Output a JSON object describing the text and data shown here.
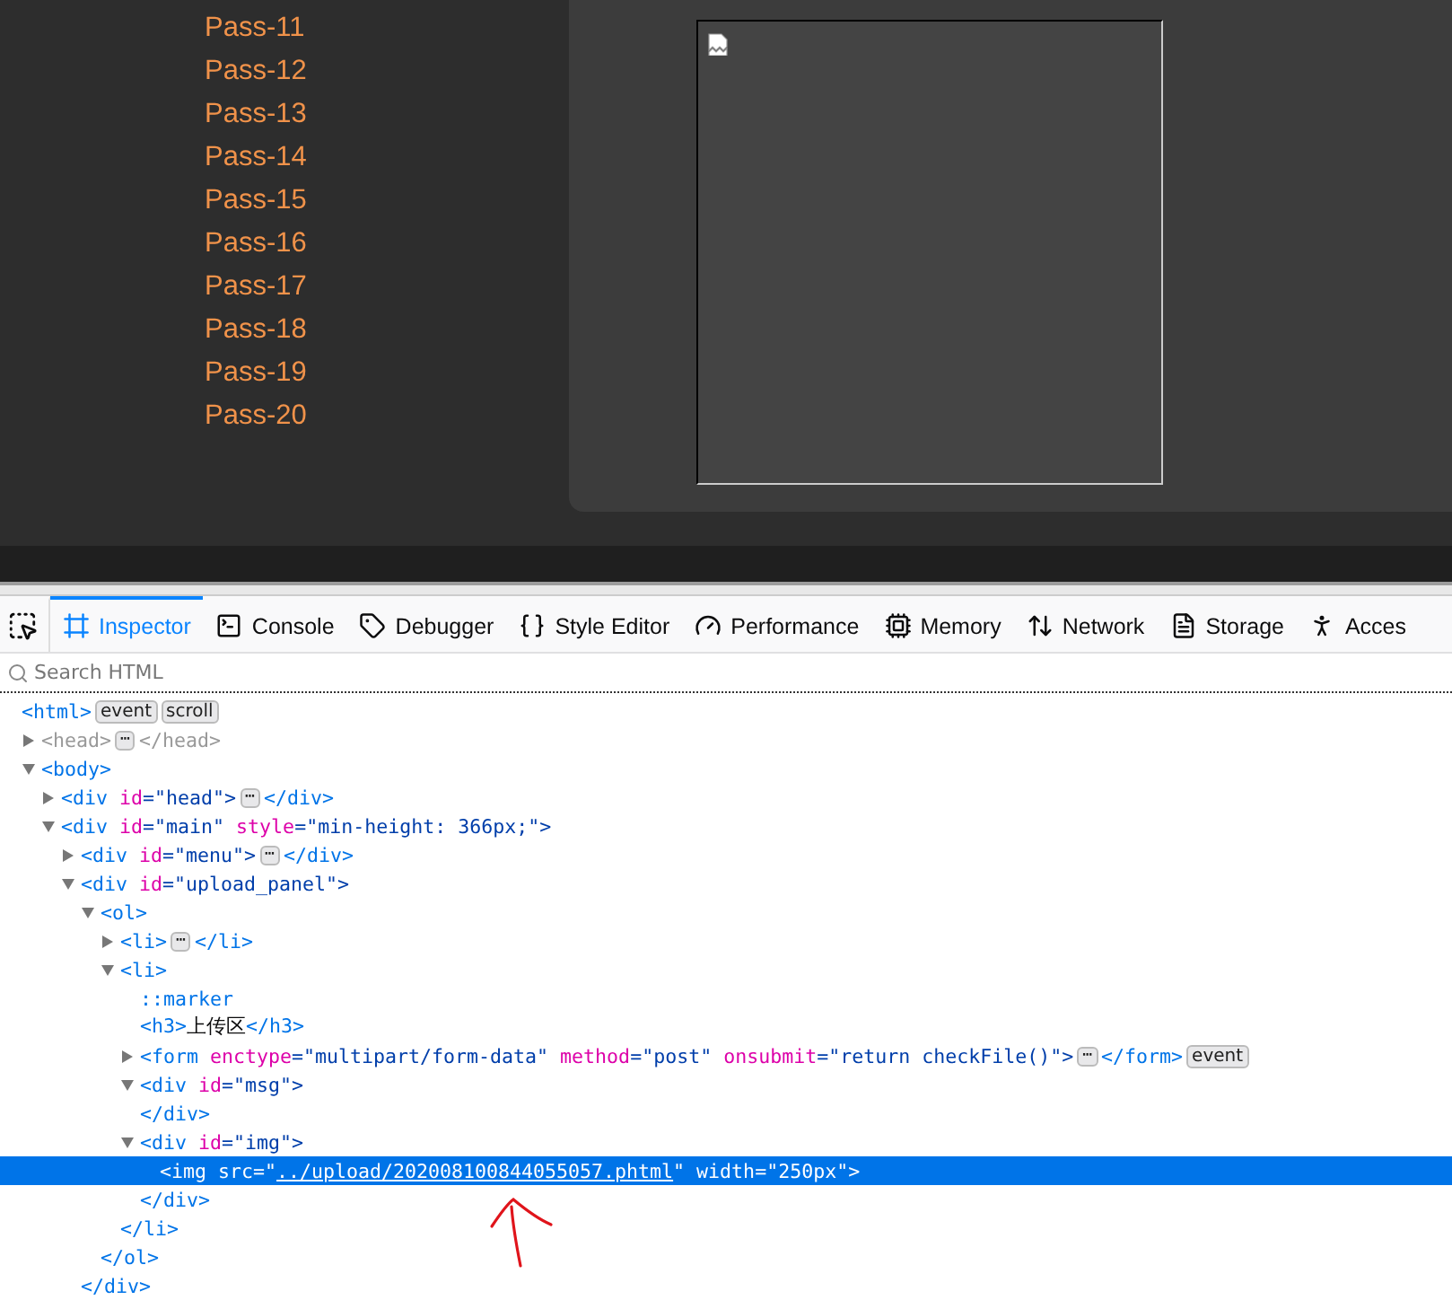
{
  "page": {
    "menu": [
      "Pass-11",
      "Pass-12",
      "Pass-13",
      "Pass-14",
      "Pass-15",
      "Pass-16",
      "Pass-17",
      "Pass-18",
      "Pass-19",
      "Pass-20"
    ]
  },
  "devtools": {
    "tabs": [
      {
        "kind": "picker",
        "selected": false
      },
      {
        "kind": "inspector",
        "label": "Inspector",
        "selected": true
      },
      {
        "kind": "console",
        "label": "Console",
        "selected": false
      },
      {
        "kind": "debugger",
        "label": "Debugger",
        "selected": false
      },
      {
        "kind": "style",
        "label": "Style Editor",
        "selected": false
      },
      {
        "kind": "performance",
        "label": "Performance",
        "selected": false
      },
      {
        "kind": "memory",
        "label": "Memory",
        "selected": false
      },
      {
        "kind": "network",
        "label": "Network",
        "selected": false
      },
      {
        "kind": "storage",
        "label": "Storage",
        "selected": false
      },
      {
        "kind": "accessibility",
        "label": "Acces",
        "selected": false
      }
    ],
    "search": {
      "placeholder": "Search HTML"
    },
    "tree": [
      {
        "selected": false,
        "dim": false,
        "line": [
          {
            "kind": "code",
            "tokens": [
              {
                "kind": "tag",
                "text": "<html>"
              }
            ]
          },
          {
            "kind": "badge",
            "label": "event"
          },
          {
            "kind": "badge",
            "label": "scroll"
          }
        ],
        "children": [
          {
            "expanded": false,
            "selected": false,
            "dim": true,
            "line": [
              {
                "kind": "code",
                "tokens": [
                  {
                    "kind": "tag",
                    "text": "<head>"
                  }
                ]
              },
              {
                "kind": "more",
                "label": "⋯"
              },
              {
                "kind": "code",
                "tokens": [
                  {
                    "kind": "tag",
                    "text": "</head>"
                  }
                ]
              }
            ]
          },
          {
            "expanded": true,
            "selected": false,
            "dim": false,
            "line": [
              {
                "kind": "code",
                "tokens": [
                  {
                    "kind": "tag",
                    "text": "<body>"
                  }
                ]
              }
            ],
            "children": [
              {
                "expanded": false,
                "selected": false,
                "dim": false,
                "line": [
                  {
                    "kind": "code",
                    "tokens": [
                      {
                        "kind": "tag",
                        "text": "<div"
                      },
                      {
                        "kind": "attr",
                        "text": " id"
                      },
                      {
                        "kind": "value",
                        "text": "=\"head\">"
                      }
                    ]
                  },
                  {
                    "kind": "more",
                    "label": "⋯"
                  },
                  {
                    "kind": "code",
                    "tokens": [
                      {
                        "kind": "tag",
                        "text": "</div>"
                      }
                    ]
                  }
                ]
              },
              {
                "expanded": true,
                "selected": false,
                "dim": false,
                "line": [
                  {
                    "kind": "code",
                    "tokens": [
                      {
                        "kind": "tag",
                        "text": "<div"
                      },
                      {
                        "kind": "attr",
                        "text": " id"
                      },
                      {
                        "kind": "value",
                        "text": "=\"main\""
                      },
                      {
                        "kind": "attr",
                        "text": " style"
                      },
                      {
                        "kind": "value",
                        "text": "=\"min-height: 366px;\">"
                      }
                    ]
                  }
                ],
                "children": [
                  {
                    "expanded": false,
                    "selected": false,
                    "dim": false,
                    "line": [
                      {
                        "kind": "code",
                        "tokens": [
                          {
                            "kind": "tag",
                            "text": "<div"
                          },
                          {
                            "kind": "attr",
                            "text": " id"
                          },
                          {
                            "kind": "value",
                            "text": "=\"menu\">"
                          }
                        ]
                      },
                      {
                        "kind": "more",
                        "label": "⋯"
                      },
                      {
                        "kind": "code",
                        "tokens": [
                          {
                            "kind": "tag",
                            "text": "</div>"
                          }
                        ]
                      }
                    ]
                  },
                  {
                    "expanded": true,
                    "selected": false,
                    "dim": false,
                    "line": [
                      {
                        "kind": "code",
                        "tokens": [
                          {
                            "kind": "tag",
                            "text": "<div"
                          },
                          {
                            "kind": "attr",
                            "text": " id"
                          },
                          {
                            "kind": "value",
                            "text": "=\"upload_panel\">"
                          }
                        ]
                      }
                    ],
                    "children": [
                      {
                        "expanded": true,
                        "selected": false,
                        "dim": false,
                        "line": [
                          {
                            "kind": "code",
                            "tokens": [
                              {
                                "kind": "tag",
                                "text": "<ol>"
                              }
                            ]
                          }
                        ],
                        "children": [
                          {
                            "expanded": false,
                            "selected": false,
                            "dim": false,
                            "line": [
                              {
                                "kind": "code",
                                "tokens": [
                                  {
                                    "kind": "tag",
                                    "text": "<li>"
                                  }
                                ]
                              },
                              {
                                "kind": "more",
                                "label": "⋯"
                              },
                              {
                                "kind": "code",
                                "tokens": [
                                  {
                                    "kind": "tag",
                                    "text": "</li>"
                                  }
                                ]
                              }
                            ]
                          },
                          {
                            "expanded": true,
                            "selected": false,
                            "dim": false,
                            "line": [
                              {
                                "kind": "code",
                                "tokens": [
                                  {
                                    "kind": "tag",
                                    "text": "<li>"
                                  }
                                ]
                              }
                            ],
                            "children": [
                              {
                                "selected": false,
                                "dim": false,
                                "line": [
                                  {
                                    "kind": "code",
                                    "tokens": [
                                      {
                                        "kind": "tag",
                                        "text": "::marker"
                                      }
                                    ]
                                  }
                                ]
                              },
                              {
                                "selected": false,
                                "dim": false,
                                "line": [
                                  {
                                    "kind": "code",
                                    "tokens": [
                                      {
                                        "kind": "tag",
                                        "text": "<h3>"
                                      },
                                      {
                                        "kind": "plain",
                                        "text": "上传区"
                                      },
                                      {
                                        "kind": "tag",
                                        "text": "</h3>"
                                      }
                                    ]
                                  }
                                ]
                              },
                              {
                                "expanded": false,
                                "selected": false,
                                "dim": false,
                                "line": [
                                  {
                                    "kind": "code",
                                    "tokens": [
                                      {
                                        "kind": "tag",
                                        "text": "<form"
                                      },
                                      {
                                        "kind": "attr",
                                        "text": " enctype"
                                      },
                                      {
                                        "kind": "value",
                                        "text": "=\"multipart/form-data\""
                                      },
                                      {
                                        "kind": "attr",
                                        "text": " method"
                                      },
                                      {
                                        "kind": "value",
                                        "text": "=\"post\""
                                      },
                                      {
                                        "kind": "attr",
                                        "text": " onsubmit"
                                      },
                                      {
                                        "kind": "value",
                                        "text": "=\"return checkFile()\">"
                                      }
                                    ]
                                  },
                                  {
                                    "kind": "more",
                                    "label": "⋯"
                                  },
                                  {
                                    "kind": "code",
                                    "tokens": [
                                      {
                                        "kind": "tag",
                                        "text": "</form>"
                                      }
                                    ]
                                  },
                                  {
                                    "kind": "badge",
                                    "label": "event"
                                  }
                                ]
                              },
                              {
                                "expanded": true,
                                "selected": false,
                                "dim": false,
                                "line": [
                                  {
                                    "kind": "code",
                                    "tokens": [
                                      {
                                        "kind": "tag",
                                        "text": "<div"
                                      },
                                      {
                                        "kind": "attr",
                                        "text": " id"
                                      },
                                      {
                                        "kind": "value",
                                        "text": "=\"msg\">"
                                      }
                                    ]
                                  }
                                ],
                                "close": "</div>"
                              },
                              {
                                "expanded": true,
                                "selected": false,
                                "dim": false,
                                "line": [
                                  {
                                    "kind": "code",
                                    "tokens": [
                                      {
                                        "kind": "tag",
                                        "text": "<div"
                                      },
                                      {
                                        "kind": "attr",
                                        "text": " id"
                                      },
                                      {
                                        "kind": "value",
                                        "text": "=\"img\">"
                                      }
                                    ]
                                  }
                                ],
                                "close": "</div>",
                                "children": [
                                  {
                                    "selected": true,
                                    "dim": false,
                                    "line": [
                                      {
                                        "kind": "code",
                                        "tokens": [
                                          {
                                            "kind": "tag",
                                            "text": "<img"
                                          },
                                          {
                                            "kind": "attr",
                                            "text": " src=\""
                                          },
                                          {
                                            "kind": "link",
                                            "text": "../upload/202008100844055057.phtml"
                                          },
                                          {
                                            "kind": "attr",
                                            "text": "\" width"
                                          },
                                          {
                                            "kind": "value",
                                            "text": "=\"250px\">"
                                          }
                                        ]
                                      }
                                    ]
                                  }
                                ]
                              }
                            ],
                            "close": "</li>"
                          }
                        ],
                        "close": "</ol>"
                      }
                    ],
                    "close": "</div>"
                  }
                ]
              }
            ]
          }
        ]
      }
    ]
  }
}
